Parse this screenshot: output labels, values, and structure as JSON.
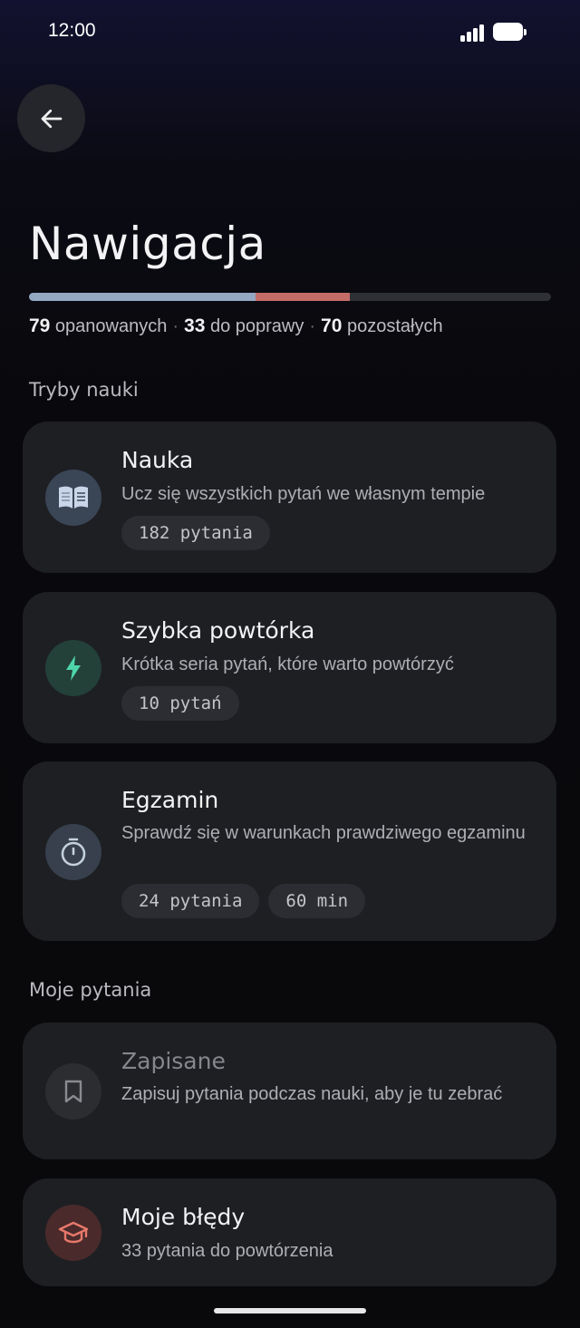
{
  "status_bar": {
    "time": "12:00"
  },
  "page": {
    "title": "Nawigacja"
  },
  "progress": {
    "mastered": 79,
    "to_improve": 33,
    "remaining": 70,
    "mastered_label": "opanowanych",
    "to_improve_label": "do poprawy",
    "remaining_label": "pozostałych",
    "colors": {
      "mastered": "#94a8c2",
      "to_improve": "#c46c67",
      "remaining": "#2f3034"
    }
  },
  "sections": {
    "study_modes": "Tryby nauki",
    "my_questions": "Moje pytania"
  },
  "modes": [
    {
      "title": "Nauka",
      "description": "Ucz się wszystkich pytań we własnym tempie",
      "pills": [
        "182 pytania"
      ],
      "icon": "book-icon"
    },
    {
      "title": "Szybka powtórka",
      "description": "Krótka seria pytań, które warto powtórzyć",
      "pills": [
        "10 pytań"
      ],
      "icon": "lightning-icon"
    },
    {
      "title": "Egzamin",
      "description": "Sprawdź się w warunkach prawdziwego egzaminu",
      "pills": [
        "24 pytania",
        "60 min"
      ],
      "icon": "stopwatch-icon"
    }
  ],
  "my_questions": [
    {
      "title": "Zapisane",
      "description": "Zapisuj pytania podczas nauki, aby je tu zebrać",
      "icon": "bookmark-icon"
    },
    {
      "title": "Moje błędy",
      "description": "33 pytania do powtórzenia",
      "icon": "graduation-cap-icon"
    }
  ]
}
